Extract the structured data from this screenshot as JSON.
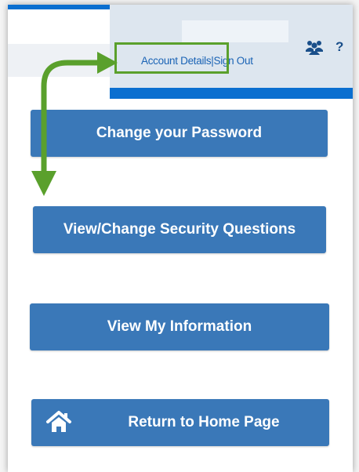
{
  "header": {
    "account_details_link": "Account Details",
    "separator": "|",
    "sign_out_link": "Sign Out",
    "help_label": "?"
  },
  "buttons": {
    "change_password": "Change your Password",
    "security_questions": "View/Change Security Questions",
    "view_information": "View My Information",
    "return_home": "Return to Home Page"
  },
  "icons": {
    "people": "people-icon",
    "help": "help-icon",
    "home": "home-icon"
  },
  "colors": {
    "button_blue": "#3a78b8",
    "header_bg": "#dde6ef",
    "accent_blue": "#0a6fd0",
    "link_blue": "#1a63b5",
    "annotation_green": "#5aa02c"
  }
}
